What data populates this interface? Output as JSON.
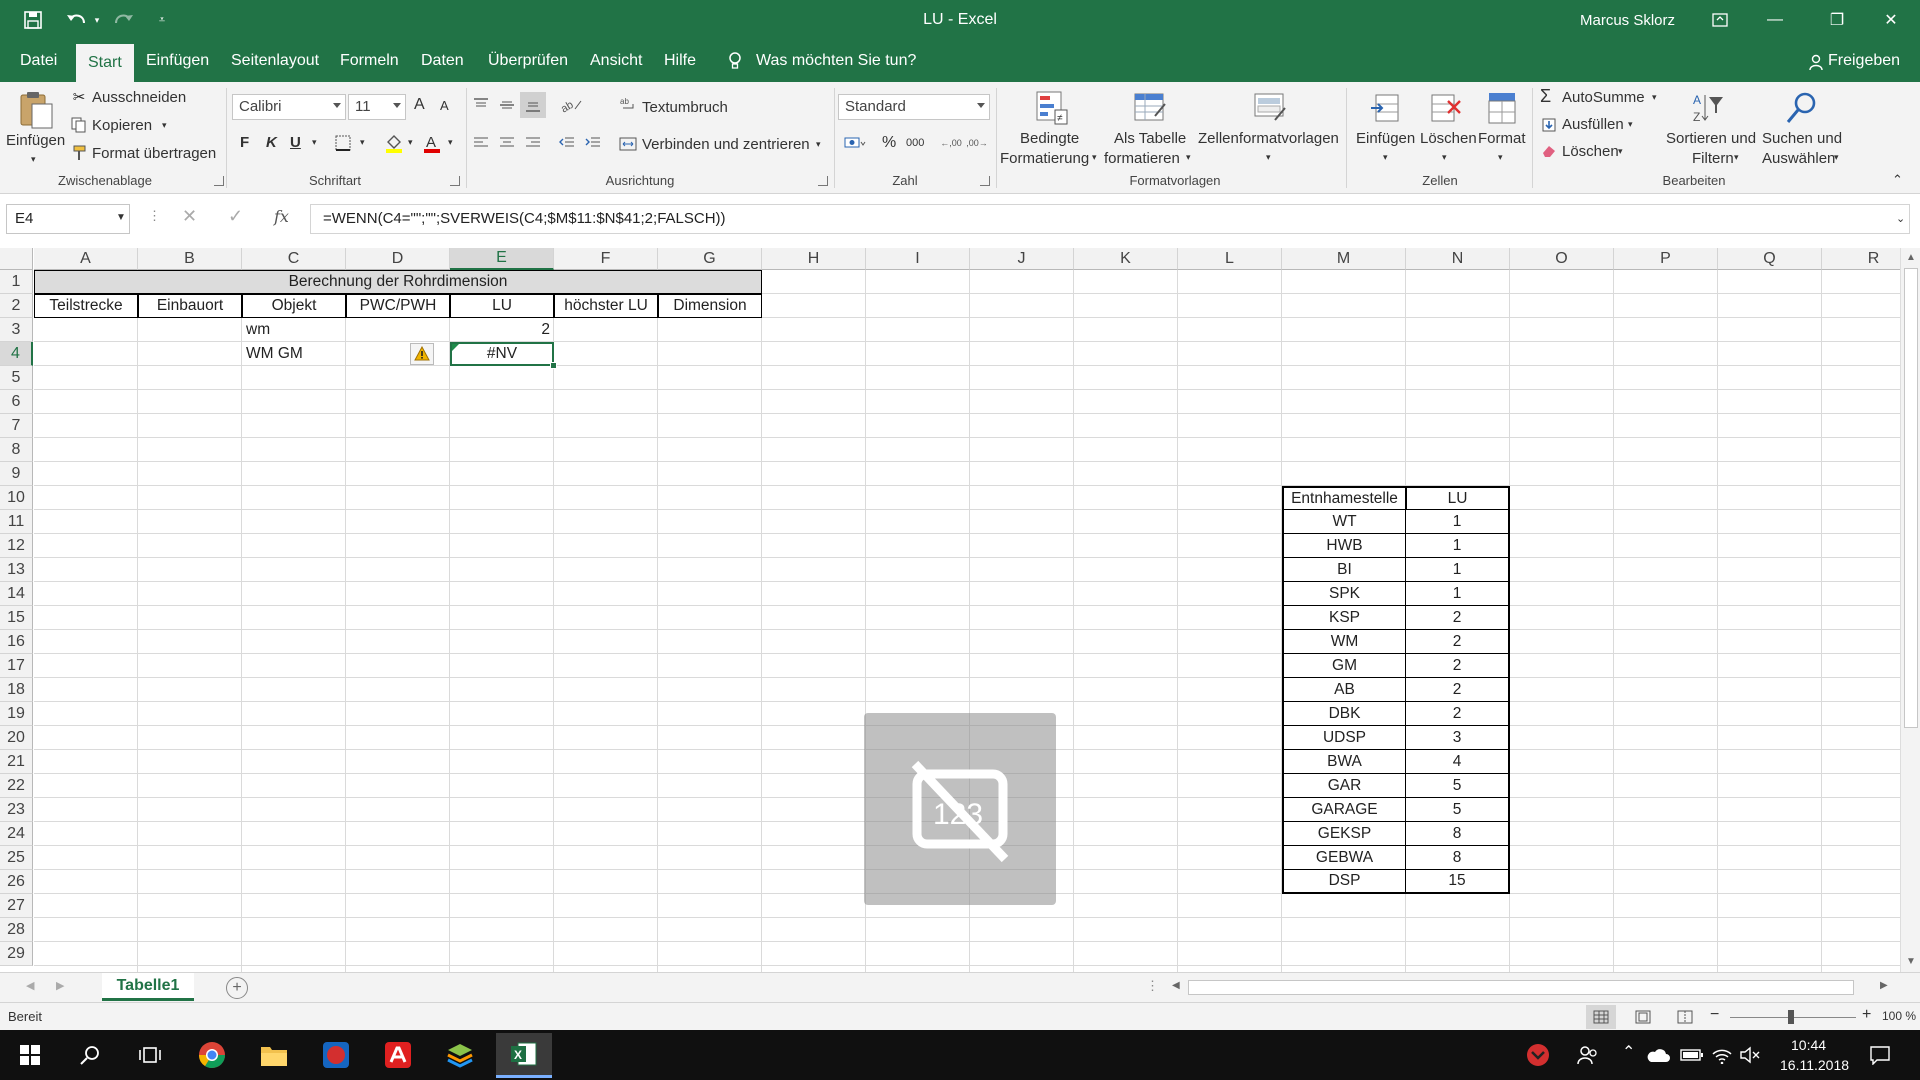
{
  "app": {
    "title": "LU  -  Excel",
    "user": "Marcus Sklorz",
    "share": "Freigeben"
  },
  "menu": [
    "Datei",
    "Start",
    "Einfügen",
    "Seitenlayout",
    "Formeln",
    "Daten",
    "Überprüfen",
    "Ansicht",
    "Hilfe"
  ],
  "tell_me": "Was möchten Sie tun?",
  "ribbon": {
    "clipboard": {
      "paste": "Einfügen",
      "cut": "Ausschneiden",
      "copy": "Kopieren",
      "format_painter": "Format übertragen",
      "label": "Zwischenablage"
    },
    "font": {
      "name": "Calibri",
      "size": "11",
      "bold": "F",
      "italic": "K",
      "underline": "U",
      "grow": "A",
      "shrink": "A",
      "label": "Schriftart"
    },
    "alignment": {
      "wrap": "Textumbruch",
      "merge": "Verbinden und zentrieren",
      "label": "Ausrichtung"
    },
    "number": {
      "format": "Standard",
      "percent": "%",
      "thousands": "000",
      "label": "Zahl"
    },
    "styles": {
      "conditional": "Bedingte",
      "conditional2": "Formatierung",
      "as_table": "Als Tabelle",
      "as_table2": "formatieren",
      "cell_styles": "Zellenformatvorlagen",
      "label": "Formatvorlagen"
    },
    "cells": {
      "insert": "Einfügen",
      "delete": "Löschen",
      "format": "Format",
      "label": "Zellen"
    },
    "editing": {
      "autosum": "AutoSumme",
      "fill": "Ausfüllen",
      "clear": "Löschen",
      "sort": "Sortieren und",
      "sort2": "Filtern",
      "find": "Suchen und",
      "find2": "Auswählen",
      "label": "Bearbeiten"
    }
  },
  "formula_bar": {
    "name_box": "E4",
    "fx": "fx",
    "formula": "=WENN(C4=\"\";\"\";SVERWEIS(C4;$M$11:$N$41;2;FALSCH))"
  },
  "columns": [
    "A",
    "B",
    "C",
    "D",
    "E",
    "F",
    "G",
    "H",
    "I",
    "J",
    "K",
    "L",
    "M",
    "N",
    "O",
    "P",
    "Q",
    "R"
  ],
  "rows": [
    "1",
    "2",
    "3",
    "4",
    "5",
    "6",
    "7",
    "8",
    "9",
    "10",
    "11",
    "12",
    "13",
    "14",
    "15",
    "16",
    "17",
    "18",
    "19",
    "20",
    "21",
    "22",
    "23",
    "24",
    "25",
    "26",
    "27",
    "28",
    "29"
  ],
  "sheet": {
    "title": "Berechnung  der Rohrdimension",
    "headers": [
      "Teilstrecke",
      "Einbauort",
      "Objekt",
      "PWC/PWH",
      "LU",
      "höchster LU",
      "Dimension"
    ],
    "c3": "wm",
    "e3": "2",
    "c4": "WM GM",
    "e4": "#NV"
  },
  "lookup": {
    "header": [
      "Entnhamestelle",
      "LU"
    ],
    "rows": [
      [
        "WT",
        "1"
      ],
      [
        "HWB",
        "1"
      ],
      [
        "BI",
        "1"
      ],
      [
        "SPK",
        "1"
      ],
      [
        "KSP",
        "2"
      ],
      [
        "WM",
        "2"
      ],
      [
        "GM",
        "2"
      ],
      [
        "AB",
        "2"
      ],
      [
        "DBK",
        "2"
      ],
      [
        "UDSP",
        "3"
      ],
      [
        "BWA",
        "4"
      ],
      [
        "GAR",
        "5"
      ],
      [
        "GARAGE",
        "5"
      ],
      [
        "GEKSP",
        "8"
      ],
      [
        "GEBWA",
        "8"
      ],
      [
        "DSP",
        "15"
      ]
    ]
  },
  "overlay_icon": "no-numbers-icon",
  "sheet_tab": "Tabelle1",
  "status": {
    "ready": "Bereit",
    "zoom": "100 %"
  },
  "taskbar": {
    "time": "10:44",
    "date": "16.11.2018"
  }
}
